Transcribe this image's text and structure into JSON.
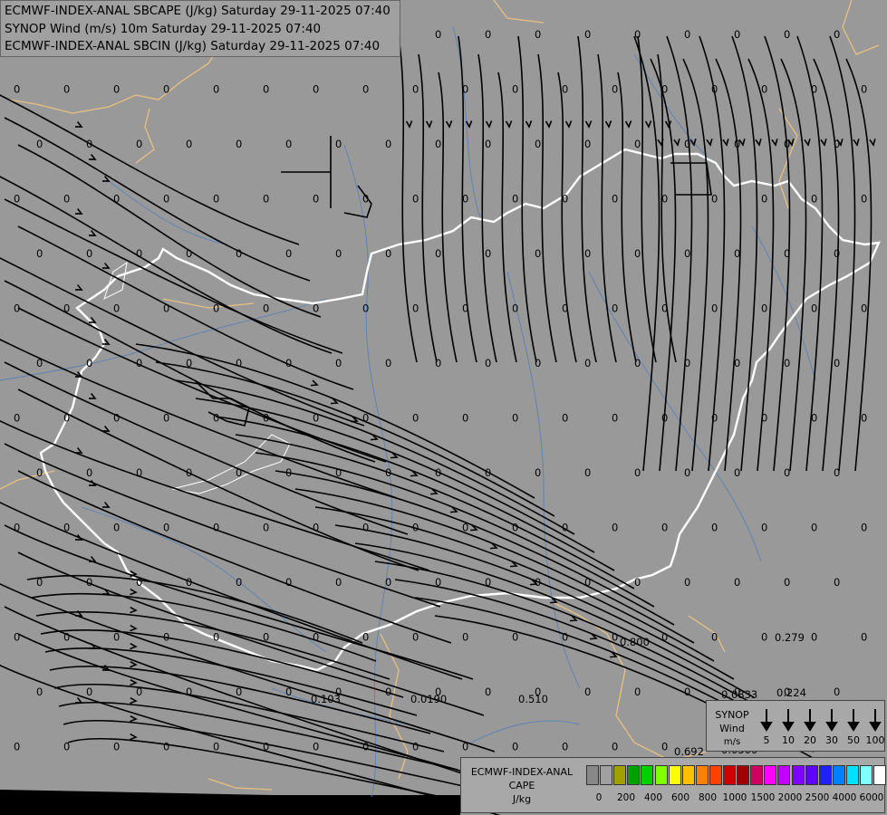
{
  "titles": [
    "ECMWF-INDEX-ANAL SBCAPE (J/kg) Saturday 29-11-2025 07:40",
    "SYNOP Wind (m/s) 10m Saturday 29-11-2025 07:40",
    "ECMWF-INDEX-ANAL SBCIN (J/kg) Saturday 29-11-2025 07:40"
  ],
  "colors": {
    "background": "#999999",
    "country_border": "#ffffff",
    "region_border": "#e8c080",
    "rivers": "#5a82b4",
    "streamlines": "#000000"
  },
  "values_layer": {
    "zero_label": "0",
    "nonzero": [
      "0.800",
      "0.279",
      "0.0833",
      "0.224",
      "0.103",
      "0.0190",
      "0.510",
      "0.692",
      "0.0300"
    ]
  },
  "wind_legend": {
    "title_lines": [
      "SYNOP",
      "Wind",
      "m/s"
    ],
    "speeds": [
      "5",
      "10",
      "20",
      "30",
      "50",
      "100"
    ]
  },
  "cape_legend": {
    "title_lines": [
      "ECMWF-INDEX-ANAL",
      "CAPE",
      "J/kg"
    ],
    "colors": [
      "#888888",
      "#a0a0a0",
      "#a0a000",
      "#00a000",
      "#00d000",
      "#80ff00",
      "#ffff00",
      "#ffc000",
      "#ff8000",
      "#ff4000",
      "#d00000",
      "#a00000",
      "#d00060",
      "#ff00ff",
      "#c000ff",
      "#8000ff",
      "#6000ff",
      "#2020ff",
      "#0080ff",
      "#00e0ff",
      "#80ffff",
      "#ffffff"
    ],
    "ticks": [
      "0",
      "200",
      "400",
      "600",
      "800",
      "1000",
      "1500",
      "2000",
      "2500",
      "4000",
      "6000"
    ]
  }
}
